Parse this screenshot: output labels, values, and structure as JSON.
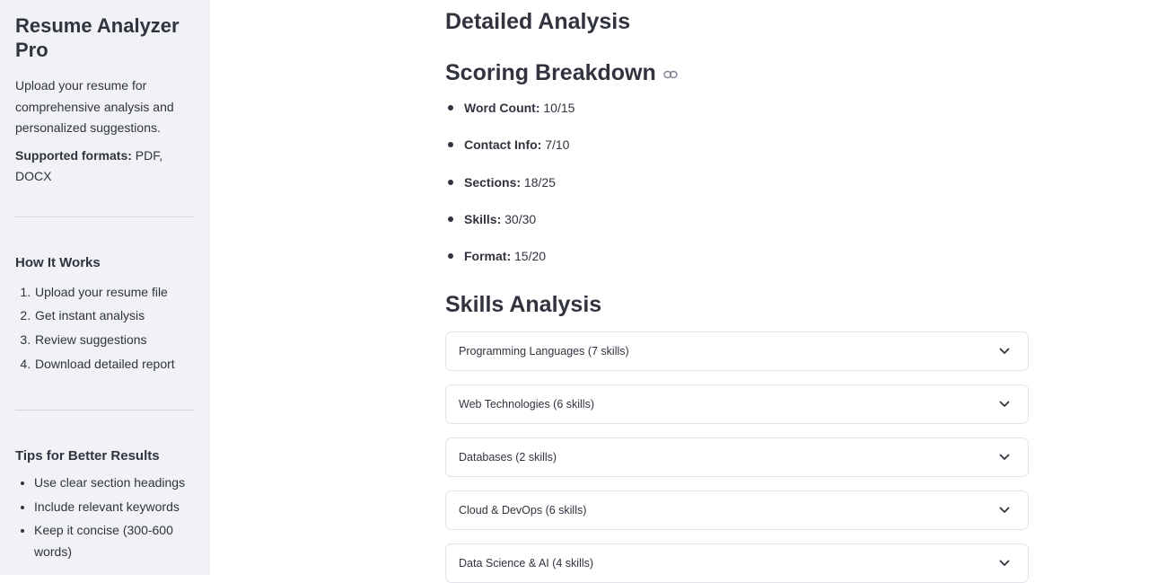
{
  "sidebar": {
    "title": "Resume Analyzer Pro",
    "intro": "Upload your resume for comprehensive analysis and personalized suggestions.",
    "formats_label": "Supported formats:",
    "formats_value": "PDF, DOCX",
    "how_heading": "How It Works",
    "how_steps": [
      "Upload your resume file",
      "Get instant analysis",
      "Review suggestions",
      "Download detailed report"
    ],
    "tips_heading": "Tips for Better Results",
    "tips": [
      "Use clear section headings",
      "Include relevant keywords",
      "Keep it concise (300-600 words)"
    ]
  },
  "main": {
    "detailed_heading": "Detailed Analysis",
    "scoring_heading": "Scoring Breakdown",
    "scores": [
      {
        "label": "Word Count:",
        "value": "10/15"
      },
      {
        "label": "Contact Info:",
        "value": "7/10"
      },
      {
        "label": "Sections:",
        "value": "18/25"
      },
      {
        "label": "Skills:",
        "value": "30/30"
      },
      {
        "label": "Format:",
        "value": "15/20"
      }
    ],
    "skills_heading": "Skills Analysis",
    "skill_groups": [
      "Programming Languages (7 skills)",
      "Web Technologies (6 skills)",
      "Databases (2 skills)",
      "Cloud & DevOps (6 skills)",
      "Data Science & AI (4 skills)"
    ]
  },
  "icons": {
    "heading_anchor": "link-icon",
    "expander_toggle": "chevron-down-icon"
  }
}
